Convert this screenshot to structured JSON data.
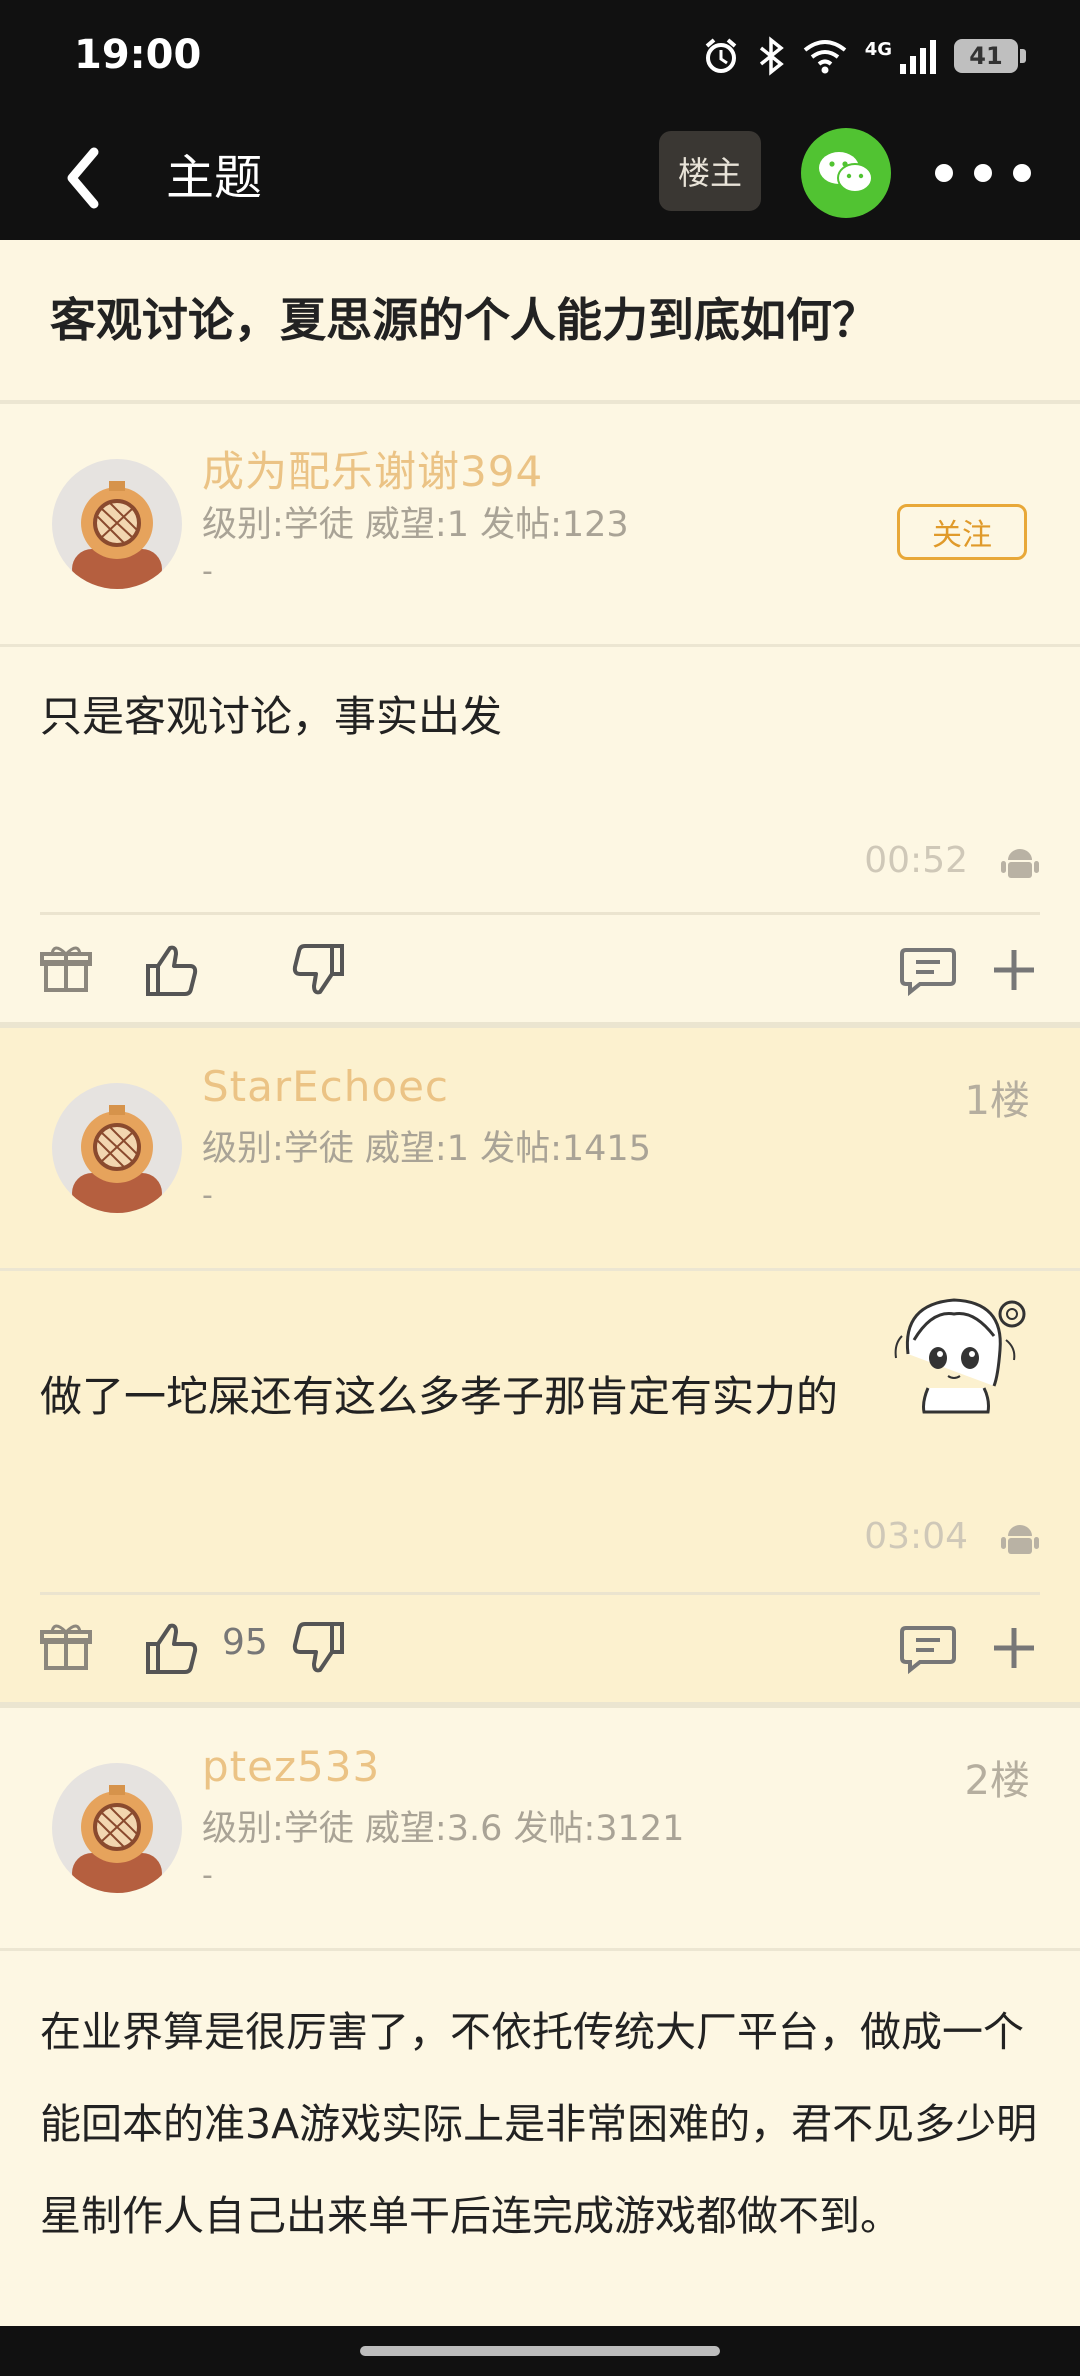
{
  "status_bar": {
    "time": "19:00",
    "network": "4G",
    "battery": "41"
  },
  "nav": {
    "title": "主题",
    "op_button": "楼主"
  },
  "topic": {
    "title": "客观讨论，夏思源的个人能力到底如何？"
  },
  "posts": [
    {
      "username": "成为配乐谢谢394",
      "meta": "级别:学徒 威望:1 发帖:123",
      "dash": "-",
      "follow_label": "关注",
      "content": "只是客观讨论，事实出发",
      "time": "00:52"
    },
    {
      "username": "StarEchoec",
      "meta": "级别:学徒 威望:1 发帖:1415",
      "dash": "-",
      "floor": "1楼",
      "content": "做了一坨屎还有这么多孝子那肯定有实力的",
      "time": "03:04",
      "likes": "95"
    },
    {
      "username": "ptez533",
      "meta": "级别:学徒 威望:3.6 发帖:3121",
      "dash": "-",
      "floor": "2楼",
      "content": "在业界算是很厉害了，不依托传统大厂平台，做成一个能回本的准3A游戏实际上是非常困难的，君不见多少明星制作人自己出来单干后连完成游戏都做不到。"
    }
  ],
  "colors": {
    "background": "#fdf7e3",
    "highlight_post": "#fcf1cf",
    "username": "#ebc385",
    "follow": "#e8a838",
    "wechat": "#51c332"
  }
}
